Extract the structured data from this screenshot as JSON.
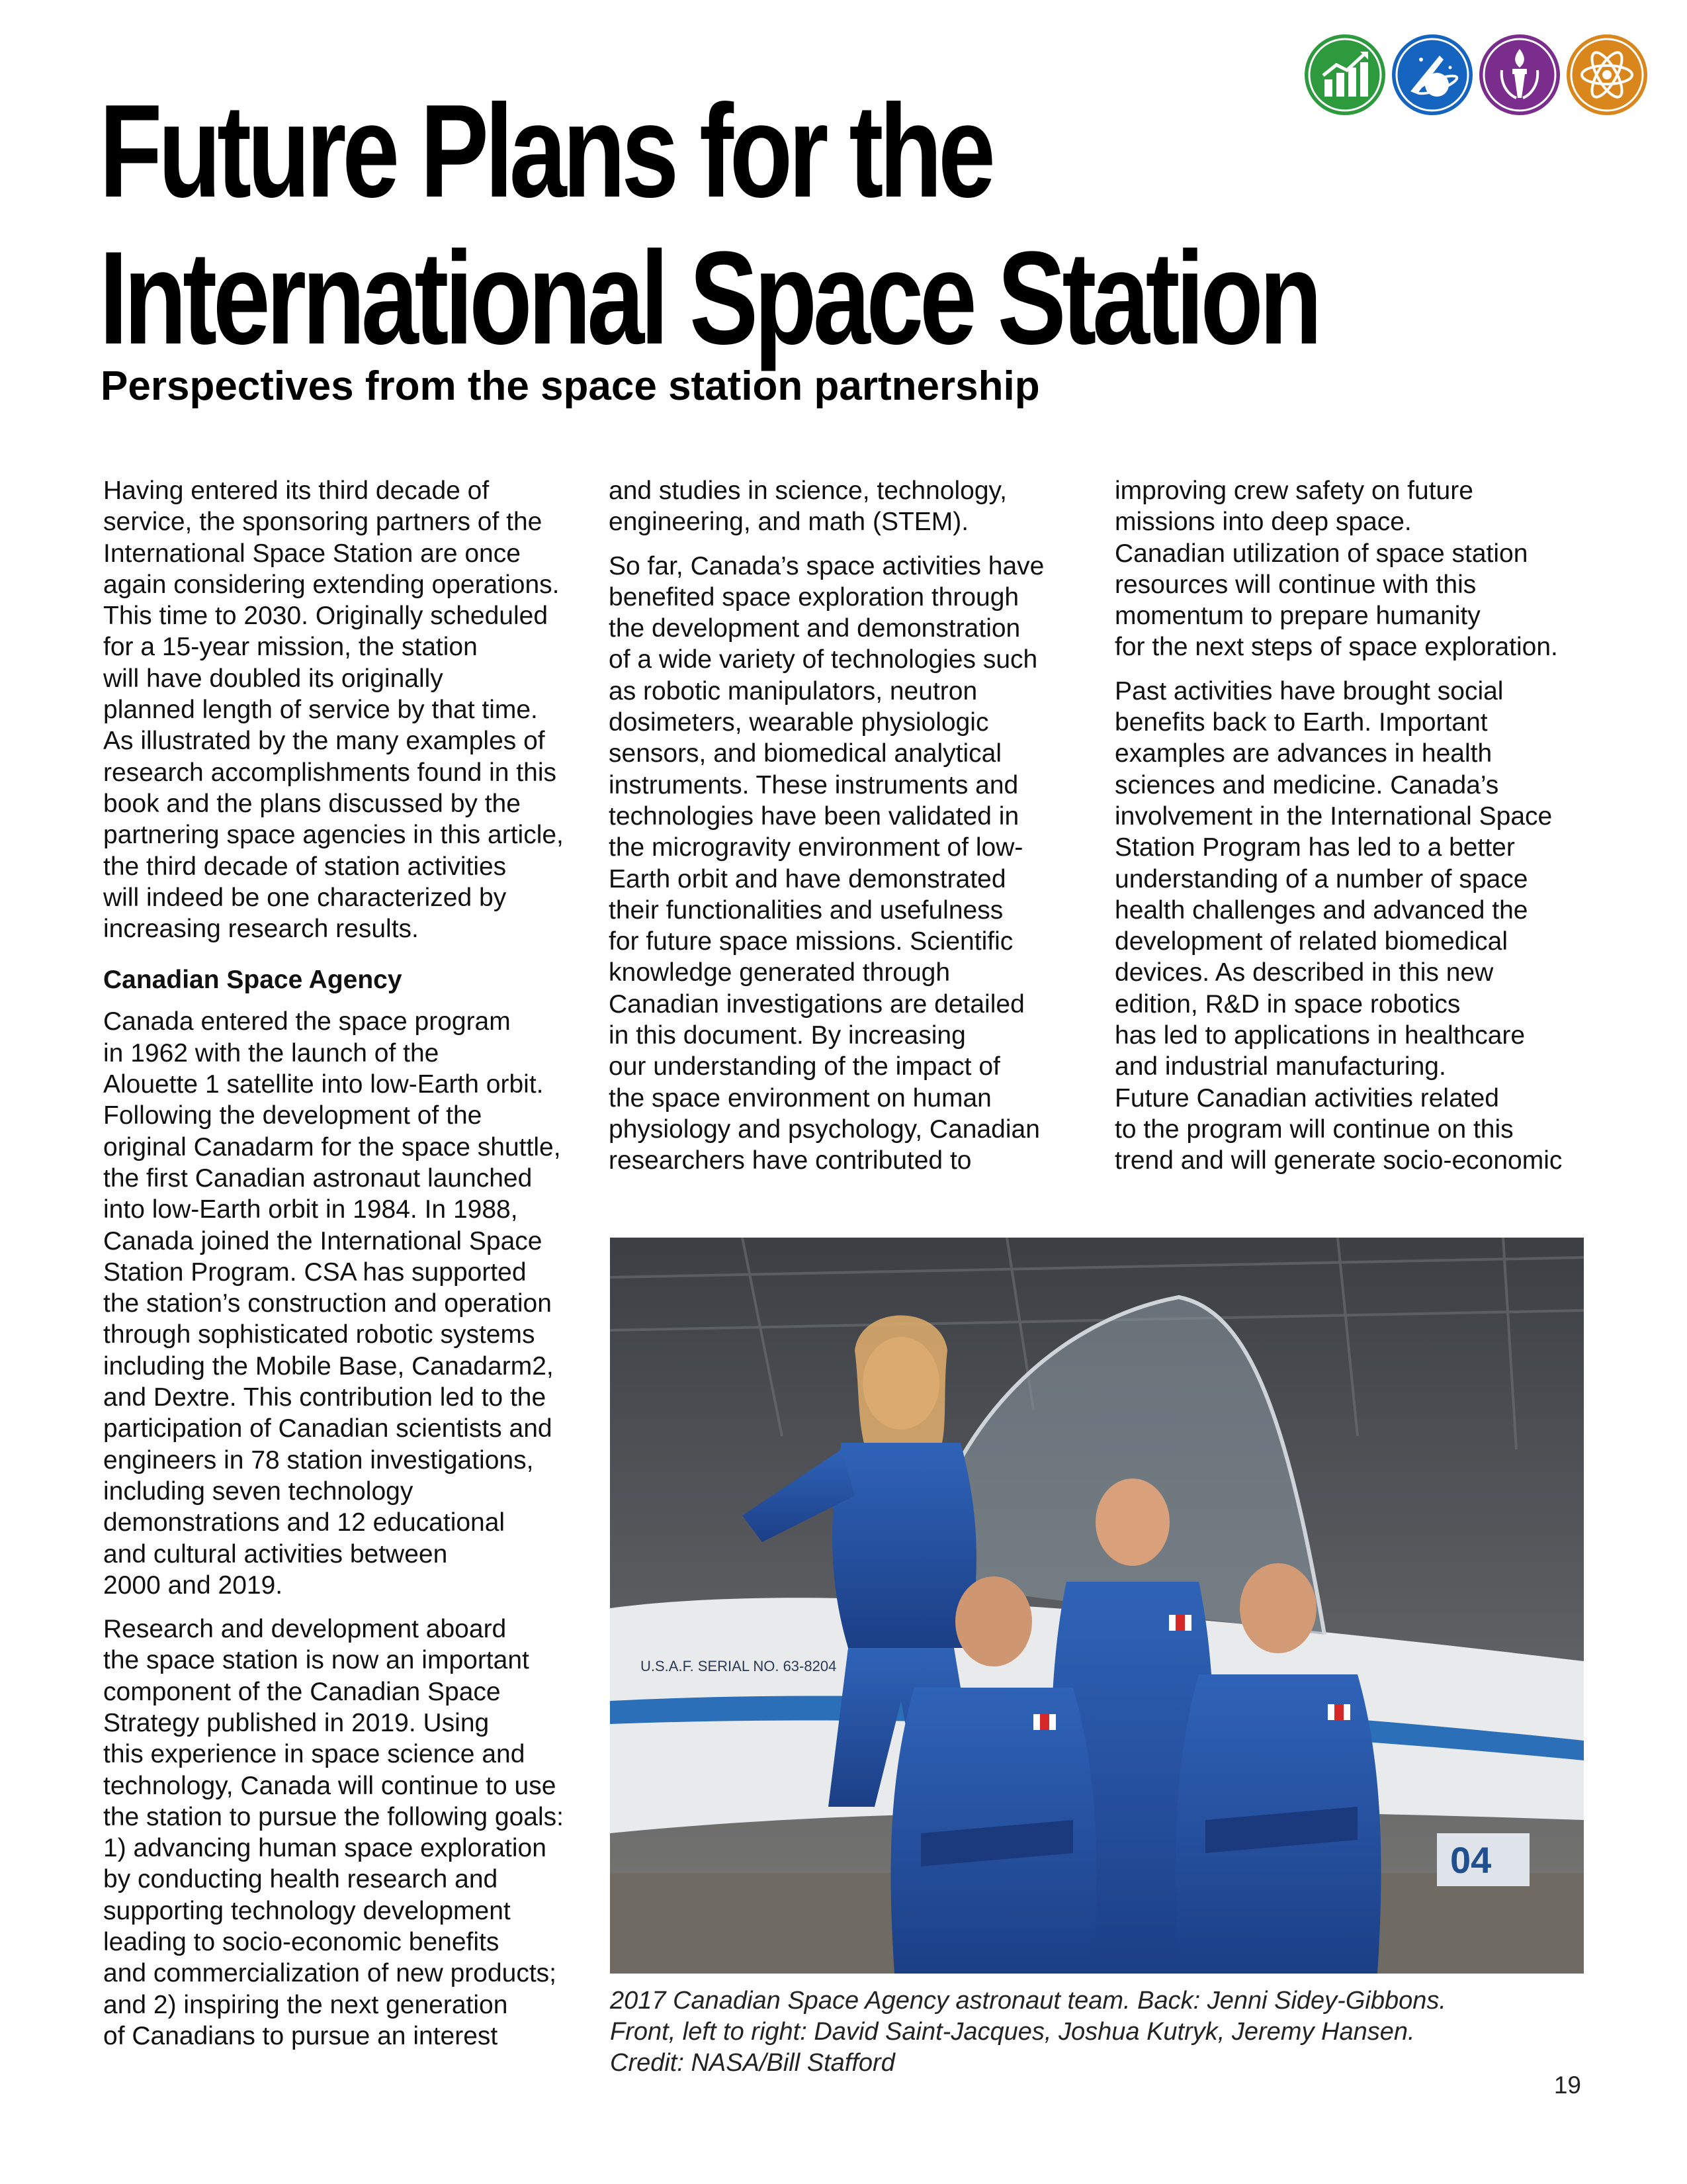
{
  "title_line1": "Future Plans for the",
  "title_line2": "International Space Station",
  "subtitle": "Perspectives from the space station partnership",
  "icons": [
    {
      "name": "economic-development-icon",
      "color": "#2e9a3e"
    },
    {
      "name": "space-exploration-icon",
      "color": "#1565c0"
    },
    {
      "name": "education-torch-icon",
      "color": "#7b2d8e"
    },
    {
      "name": "atom-science-icon",
      "color": "#d9871d"
    }
  ],
  "col1": {
    "p1": "Having entered its third decade of\nservice, the sponsoring partners of the\nInternational Space Station are once\nagain considering extending operations.\nThis time to 2030. Originally scheduled\nfor a 15-year mission, the station\nwill have doubled its originally\nplanned length of service by that time.\nAs illustrated by the many examples of\nresearch accomplishments found in this\nbook and the plans discussed by the\npartnering space agencies in this article,\nthe third decade of station activities\nwill indeed be one characterized by\nincreasing research results.",
    "heading": "Canadian Space Agency",
    "p2": "Canada entered the space program\nin 1962 with the launch of the\nAlouette 1 satellite into low-Earth orbit.\nFollowing the development of the\noriginal Canadarm for the space shuttle,\nthe first Canadian astronaut launched\ninto low-Earth orbit in 1984. In 1988,\nCanada joined the International Space\nStation Program. CSA has supported\nthe station’s construction and operation\nthrough sophisticated robotic systems\nincluding the Mobile Base, Canadarm2,\nand Dextre. This contribution led to the\nparticipation of Canadian scientists and\nengineers in 78 station investigations,\nincluding seven technology\ndemonstrations and 12 educational\nand cultural activities between\n2000 and 2019.",
    "p3": "Research and development aboard\nthe space station is now an important\ncomponent of the Canadian Space\nStrategy published in 2019. Using\nthis experience in space science and\ntechnology, Canada will continue to use\nthe station to pursue the following goals:\n1) advancing human space exploration\nby conducting health research and\nsupporting technology development\nleading to socio-economic benefits\nand commercialization of new products;\nand 2) inspiring the next generation\nof Canadians to pursue an interest"
  },
  "col2": {
    "p1": "and studies in science, technology,\nengineering, and math (STEM).",
    "p2": "So far, Canada’s space activities have\nbenefited space exploration through\nthe development and demonstration\nof a wide variety of technologies such\nas robotic manipulators, neutron\ndosimeters, wearable physiologic\nsensors, and biomedical analytical\ninstruments. These instruments and\ntechnologies have been validated in\nthe microgravity environment of low-\nEarth orbit and have demonstrated\ntheir functionalities and usefulness\nfor future space missions. Scientific\nknowledge generated through\nCanadian investigations are detailed\nin this document. By increasing\nour understanding of the impact of\nthe space environment on human\nphysiology and psychology, Canadian\nresearchers have contributed to"
  },
  "col3": {
    "p1": "improving crew safety on future\nmissions into deep space.\nCanadian utilization of space station\nresources will continue with this\nmomentum to prepare humanity\nfor the next steps of space exploration.",
    "p2": "Past activities have brought social\nbenefits back to Earth. Important\nexamples are advances in health\nsciences and medicine. Canada’s\ninvolvement in the International Space\nStation Program has led to a better\nunderstanding of a number of space\nhealth challenges and advanced the\ndevelopment of related biomedical\ndevices. As described in this new\nedition, R&D in space robotics\nhas led to applications in healthcare\nand industrial manufacturing.\nFuture Canadian activities related\nto the program will continue on this\ntrend and will generate socio-economic"
  },
  "photo": {
    "aircraft_serial": "U.S.A.F. SERIAL NO. 63-8204",
    "aircraft_number": "04"
  },
  "caption": "2017 Canadian Space Agency astronaut team. Back: Jenni Sidey-Gibbons.\nFront, left to right: David Saint-Jacques, Joshua Kutryk, Jeremy Hansen.\nCredit: NASA/Bill Stafford",
  "page_number": "19"
}
